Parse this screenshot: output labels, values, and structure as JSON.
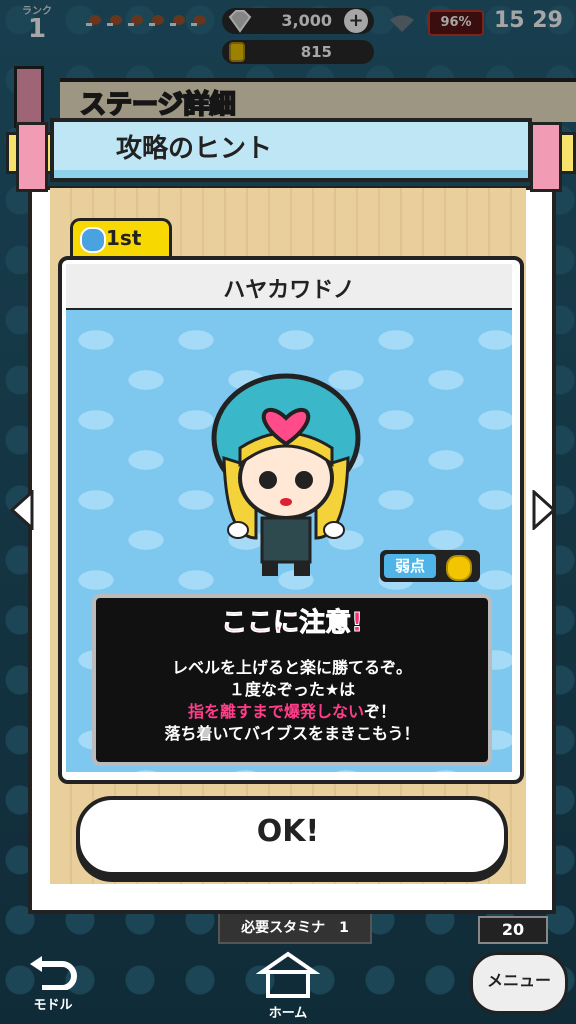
{
  "status": {
    "rank_label": "ランク",
    "rank": "1",
    "gems": "3,000",
    "gem_plus": "+",
    "coins": "815",
    "battery": "96%",
    "time": "15 29"
  },
  "background": {
    "stage_detail_title": "ステージ詳細",
    "stamina_label": "必要スタミナ　1",
    "count": "20",
    "nav_back": "モドル",
    "nav_home": "ホーム",
    "nav_menu": "メニュー"
  },
  "dialog": {
    "title": "攻略のヒント",
    "tab_label": "1st",
    "character_name": "ハヤカワドノ",
    "weak_label": "弱点",
    "hint_heading": "ここに注意!",
    "hint_line1": "レベルを上げると楽に勝てるぞ。",
    "hint_line2": "１度なぞった★は",
    "hint_line3_pink": "指を離すまで爆発しない",
    "hint_line3_rest": "ぞ！",
    "hint_line4": "落ち着いてバイブスをまきこもう！",
    "ok_label": "OK!"
  },
  "colors": {
    "accent_pink": "#ff2d6f",
    "title_panel": "#bfe6f5",
    "card_bg": "#7ec8f0",
    "tab_yellow": "#f7d800"
  },
  "icons": [
    "meat-icon",
    "gem-icon",
    "coin-icon",
    "wifi-icon",
    "drop-icon",
    "coin-weakness-icon",
    "left-arrow-icon",
    "right-arrow-icon",
    "back-arrow-icon",
    "home-icon"
  ]
}
